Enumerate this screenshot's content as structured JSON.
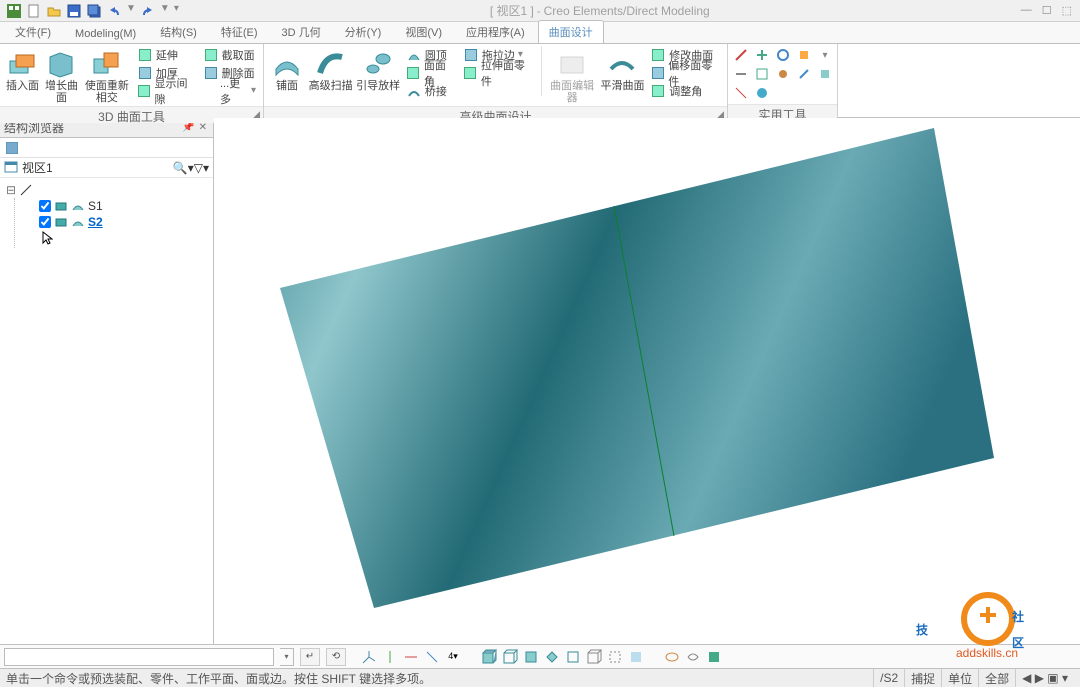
{
  "app": {
    "doc_title": "[ 视区1 ]",
    "app_title": "Creo Elements/Direct Modeling"
  },
  "menus": [
    {
      "label": "文件(F)",
      "active": false
    },
    {
      "label": "Modeling(M)",
      "active": false
    },
    {
      "label": "结构(S)",
      "active": false
    },
    {
      "label": "特征(E)",
      "active": false
    },
    {
      "label": "3D 几何",
      "active": false
    },
    {
      "label": "分析(Y)",
      "active": false
    },
    {
      "label": "视图(V)",
      "active": false
    },
    {
      "label": "应用程序(A)",
      "active": false
    },
    {
      "label": "曲面设计",
      "active": true
    }
  ],
  "ribbon": {
    "panel1": {
      "caption": "3D 曲面工具",
      "big": [
        {
          "label": "插入面"
        },
        {
          "label": "增长曲面"
        },
        {
          "label": "使面重新相交"
        }
      ],
      "small": [
        {
          "label": "延伸"
        },
        {
          "label": "加厚"
        },
        {
          "label": "显示间隙"
        },
        {
          "label": "截取面"
        },
        {
          "label": "删除面"
        },
        {
          "label": "...更多"
        }
      ]
    },
    "panel2": {
      "caption": "高级曲面设计",
      "big": [
        {
          "label": "铺面"
        },
        {
          "label": "高级扫描"
        },
        {
          "label": "引导放样"
        }
      ],
      "small": [
        {
          "label": "圆顶"
        },
        {
          "label": "面面角"
        },
        {
          "label": "桥接"
        },
        {
          "label": "拖拉边"
        },
        {
          "label": "拉伸面零件"
        }
      ],
      "big2": [
        {
          "label": "曲面编辑器",
          "disabled": true
        },
        {
          "label": "平滑曲面"
        }
      ],
      "small2": [
        {
          "label": "修改曲面"
        },
        {
          "label": "偏移面零件"
        },
        {
          "label": "调整角"
        }
      ]
    },
    "panel3": {
      "caption": "实用工具"
    }
  },
  "browser": {
    "title": "结构浏览器",
    "viewport_label": "视区1",
    "root_label": "",
    "items": [
      {
        "label": "S1",
        "selected": false
      },
      {
        "label": "S2",
        "selected": true
      }
    ]
  },
  "status": {
    "hint": "单击一个命令或预选装配、零件、工作平面、面或边。按住 SHIFT 键选择多项。",
    "s2": "/S2",
    "capture": "捕捉",
    "unit": "单位",
    "all": "全部"
  },
  "watermark": "addskills.cn"
}
